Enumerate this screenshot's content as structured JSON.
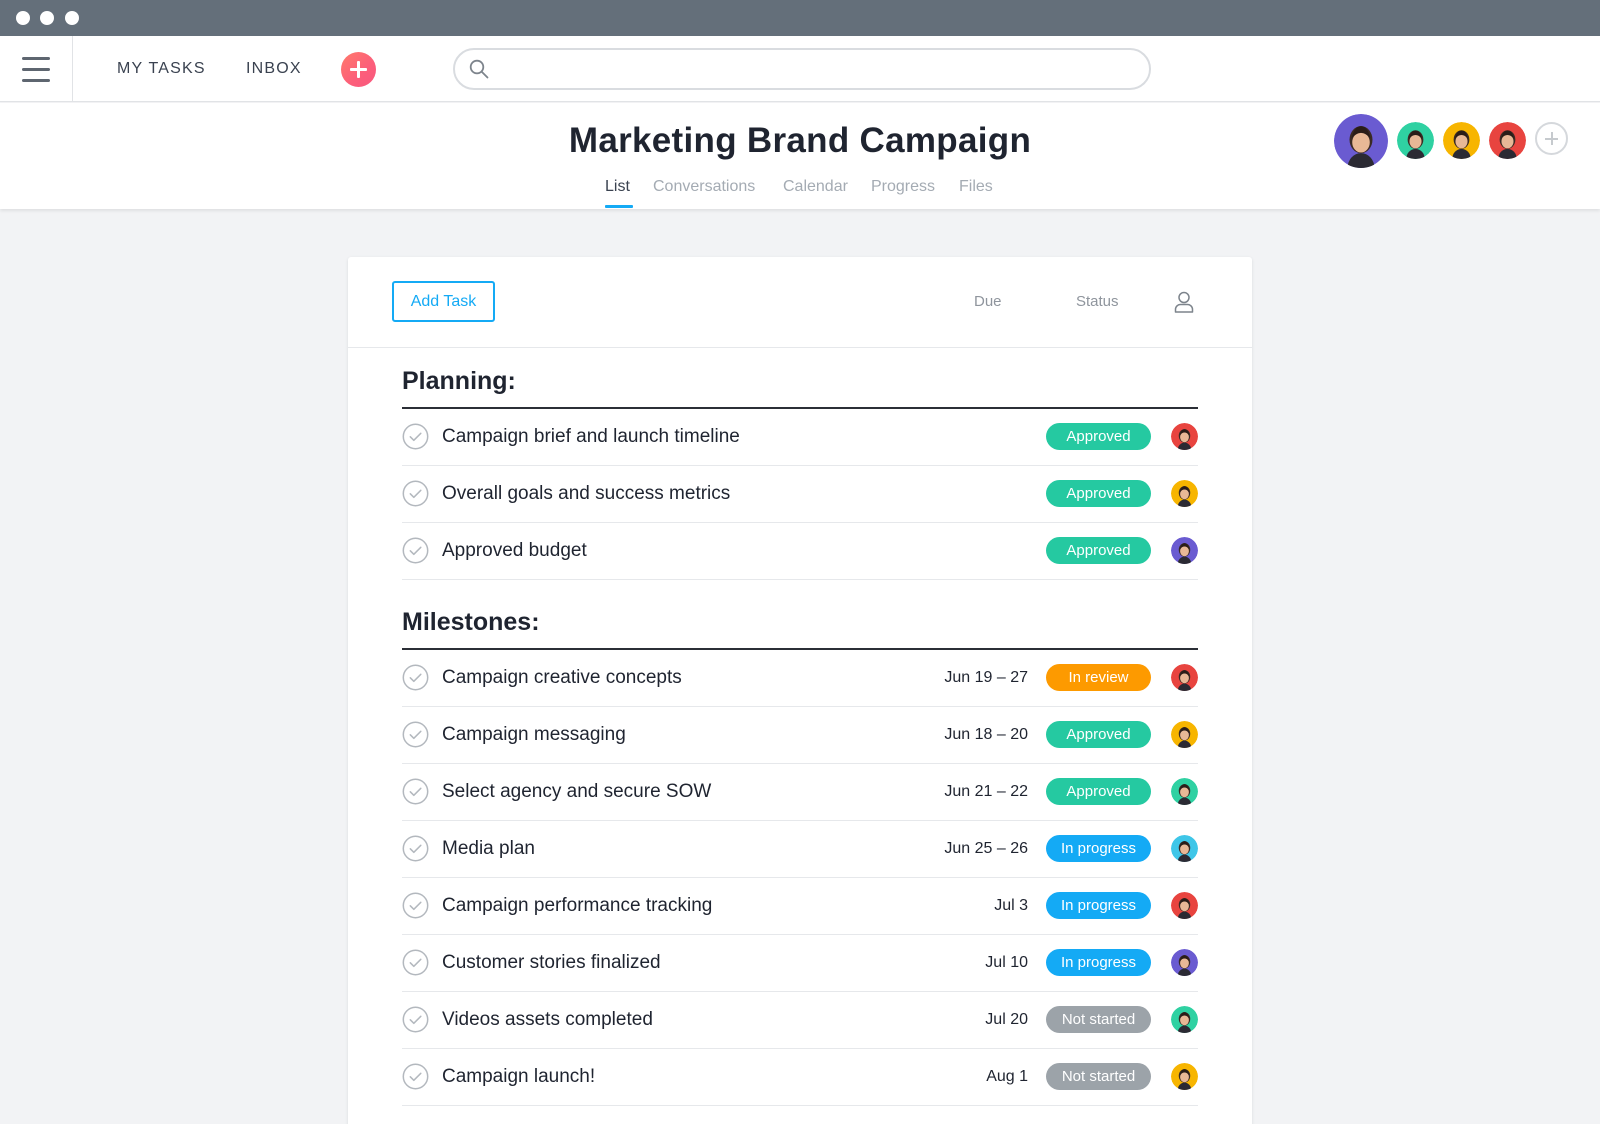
{
  "nav": {
    "my_tasks": "MY TASKS",
    "inbox": "INBOX",
    "search_placeholder": ""
  },
  "project": {
    "title": "Marketing Brand Campaign",
    "tabs": [
      "List",
      "Conversations",
      "Calendar",
      "Progress",
      "Files"
    ],
    "active_tab": "List"
  },
  "toolbar": {
    "add_task": "Add Task",
    "col_due": "Due",
    "col_status": "Status"
  },
  "status_colors": {
    "Approved": "#25c9a1",
    "In review": "#fd9a00",
    "In progress": "#14aaf5",
    "Not started": "#9ca3a9"
  },
  "sections": [
    {
      "title": "Planning:",
      "tasks": [
        {
          "name": "Campaign brief and launch timeline",
          "due": "",
          "status": "Approved",
          "assignee": "red"
        },
        {
          "name": "Overall goals and success metrics",
          "due": "",
          "status": "Approved",
          "assignee": "yellow"
        },
        {
          "name": "Approved budget",
          "due": "",
          "status": "Approved",
          "assignee": "purple"
        }
      ]
    },
    {
      "title": "Milestones:",
      "tasks": [
        {
          "name": "Campaign creative concepts",
          "due": "Jun 19 – 27",
          "status": "In review",
          "assignee": "red"
        },
        {
          "name": "Campaign messaging",
          "due": "Jun 18 – 20",
          "status": "Approved",
          "assignee": "yellow"
        },
        {
          "name": "Select agency and secure SOW",
          "due": "Jun 21 – 22",
          "status": "Approved",
          "assignee": "green"
        },
        {
          "name": "Media plan",
          "due": "Jun 25 – 26",
          "status": "In progress",
          "assignee": "blue"
        },
        {
          "name": "Campaign performance tracking",
          "due": "Jul 3",
          "status": "In progress",
          "assignee": "red"
        },
        {
          "name": "Customer stories finalized",
          "due": "Jul 10",
          "status": "In progress",
          "assignee": "purple"
        },
        {
          "name": "Videos assets completed",
          "due": "Jul 20",
          "status": "Not started",
          "assignee": "green"
        },
        {
          "name": "Campaign launch!",
          "due": "Aug 1",
          "status": "Not started",
          "assignee": "yellow"
        }
      ]
    }
  ],
  "avatar_colors": {
    "purple": "#6a5bd1",
    "green": "#2fd1a2",
    "yellow": "#f7b500",
    "red": "#e8443f",
    "blue": "#3ec6e8"
  },
  "members": [
    "purple",
    "green",
    "yellow",
    "red"
  ]
}
